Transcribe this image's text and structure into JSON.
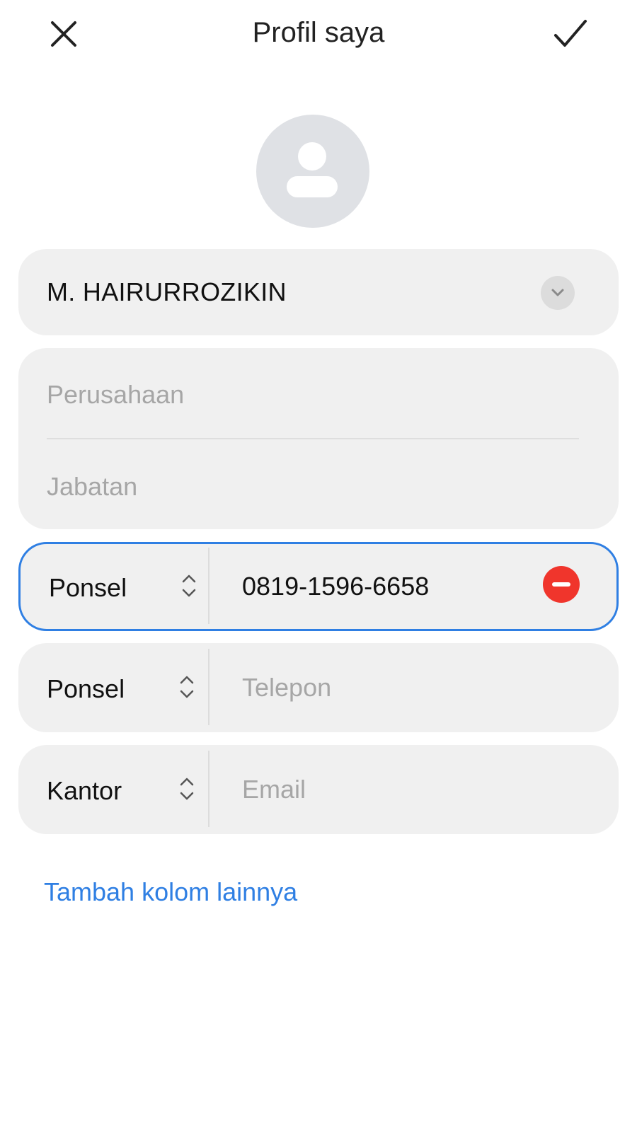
{
  "header": {
    "title": "Profil saya",
    "close_icon": "close-icon",
    "confirm_icon": "check-icon"
  },
  "avatar": {
    "icon": "person-icon"
  },
  "name": {
    "value": "M. HAIRURROZIKIN",
    "expand_icon": "chevron-down-icon"
  },
  "company": {
    "placeholder": "Perusahaan",
    "value": ""
  },
  "job_title": {
    "placeholder": "Jabatan",
    "value": ""
  },
  "phones": [
    {
      "type": "Ponsel",
      "value": "0819-1596-6658",
      "placeholder": "Telepon",
      "active": true
    },
    {
      "type": "Ponsel",
      "value": "",
      "placeholder": "Telepon",
      "active": false
    }
  ],
  "email": {
    "type": "Kantor",
    "value": "",
    "placeholder": "Email"
  },
  "add_field_link": "Tambah kolom lainnya",
  "colors": {
    "accent": "#2f7fe3",
    "remove": "#f0352c",
    "card_bg": "#f0f0f0",
    "avatar_bg": "#dfe1e5",
    "placeholder": "#a6a6a6"
  }
}
